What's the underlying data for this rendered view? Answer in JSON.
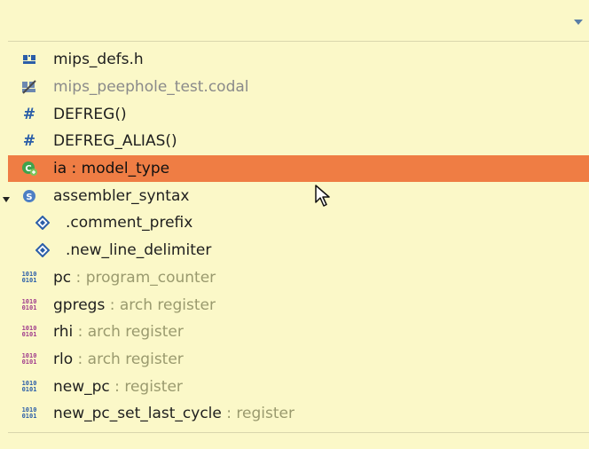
{
  "outline": {
    "dropdown_icon": "chevron-down-icon",
    "items": [
      {
        "label": "mips_defs.h",
        "icon": "header-file-icon",
        "dim": false,
        "level": 0
      },
      {
        "label": "mips_peephole_test.codal",
        "icon": "codal-file-icon",
        "dim": true,
        "level": 0
      },
      {
        "label": "DEFREG()",
        "icon": "macro-hash-icon",
        "dim": false,
        "level": 0
      },
      {
        "label": "DEFREG_ALIAS()",
        "icon": "macro-hash-icon",
        "dim": false,
        "level": 0
      },
      {
        "label": "ia : model_type",
        "icon": "model-type-icon",
        "dim": false,
        "level": 0,
        "selected": true
      },
      {
        "label": "assembler_syntax",
        "icon": "syntax-s-icon",
        "dim": false,
        "level": 0,
        "expanded": true
      },
      {
        "label": ".comment_prefix",
        "icon": "diamond-icon",
        "dim": false,
        "level": 1
      },
      {
        "label": ".new_line_delimiter",
        "icon": "diamond-icon",
        "dim": false,
        "level": 1
      },
      {
        "label": "pc",
        "type": "program_counter",
        "icon": "register-blue-icon",
        "level": 0
      },
      {
        "label": "gpregs",
        "type": "arch register",
        "icon": "register-purple-icon",
        "level": 0
      },
      {
        "label": "rhi",
        "type": "arch register",
        "icon": "register-purple-icon",
        "level": 0
      },
      {
        "label": "rlo",
        "type": "arch register",
        "icon": "register-purple-icon",
        "level": 0
      },
      {
        "label": "new_pc",
        "type": "register",
        "icon": "register-blue-icon",
        "level": 0
      },
      {
        "label": "new_pc_set_last_cycle",
        "type": "register",
        "icon": "register-blue-icon",
        "level": 0
      }
    ]
  },
  "colors": {
    "background": "#fbf8c8",
    "selection": "#ef7d44",
    "type_text": "#9a9a6e",
    "blue_icon": "#2b5ea8",
    "purple_icon": "#a03c8c"
  }
}
